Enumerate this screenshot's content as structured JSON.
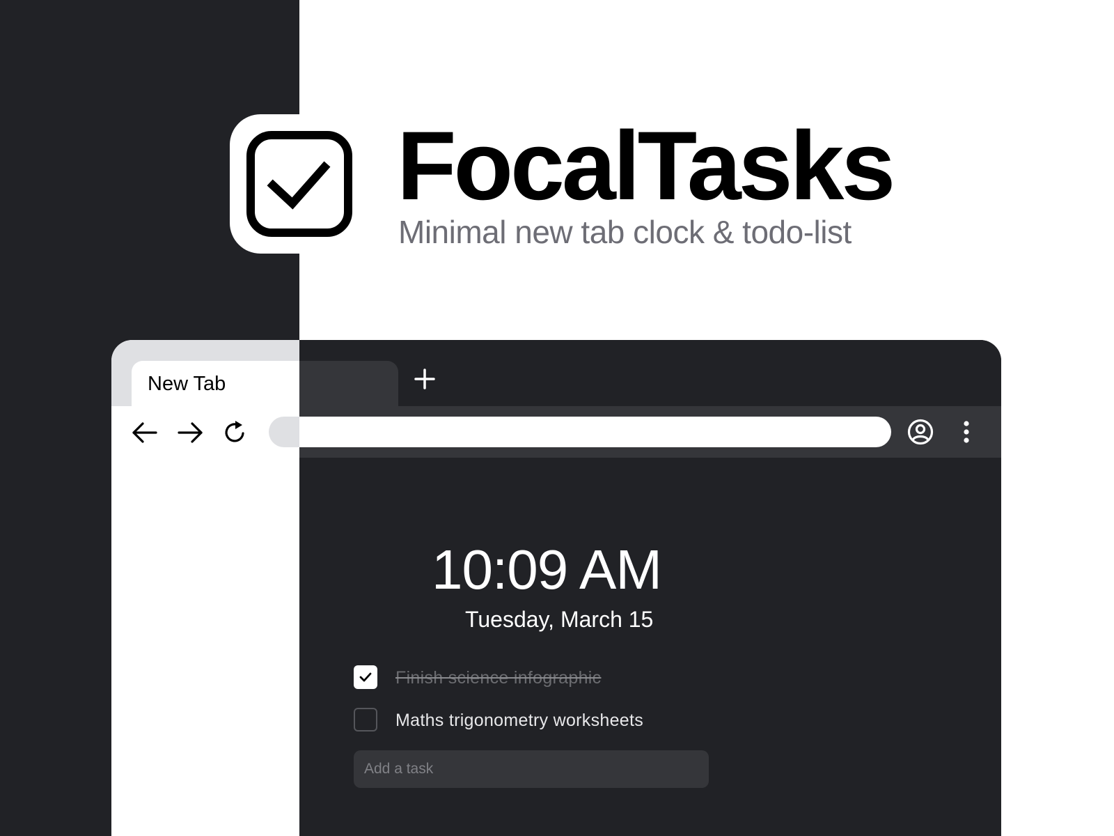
{
  "brand": {
    "title": "FocalTasks",
    "subtitle": "Minimal new tab clock & todo-list",
    "logo_icon": "checkbox-checked-icon"
  },
  "browser": {
    "tab_title": "New Tab",
    "new_tab_icon": "plus-icon",
    "nav": {
      "back_icon": "arrow-left-icon",
      "forward_icon": "arrow-right-icon",
      "reload_icon": "reload-icon",
      "profile_icon": "account-circle-icon",
      "menu_icon": "kebab-menu-icon"
    },
    "address_value": ""
  },
  "newtab": {
    "time": "10:09 AM",
    "date": "Tuesday, March 15",
    "tasks": [
      {
        "label": "Finish science infographic",
        "done": true
      },
      {
        "label": "Maths trigonometry worksheets",
        "done": false
      }
    ],
    "add_task_placeholder": "Add a task"
  },
  "colors": {
    "dark_bg": "#212226",
    "toolbar_dark": "#35363a",
    "light_tabbar": "#dfe0e3",
    "subtitle_gray": "#6d6d75"
  }
}
